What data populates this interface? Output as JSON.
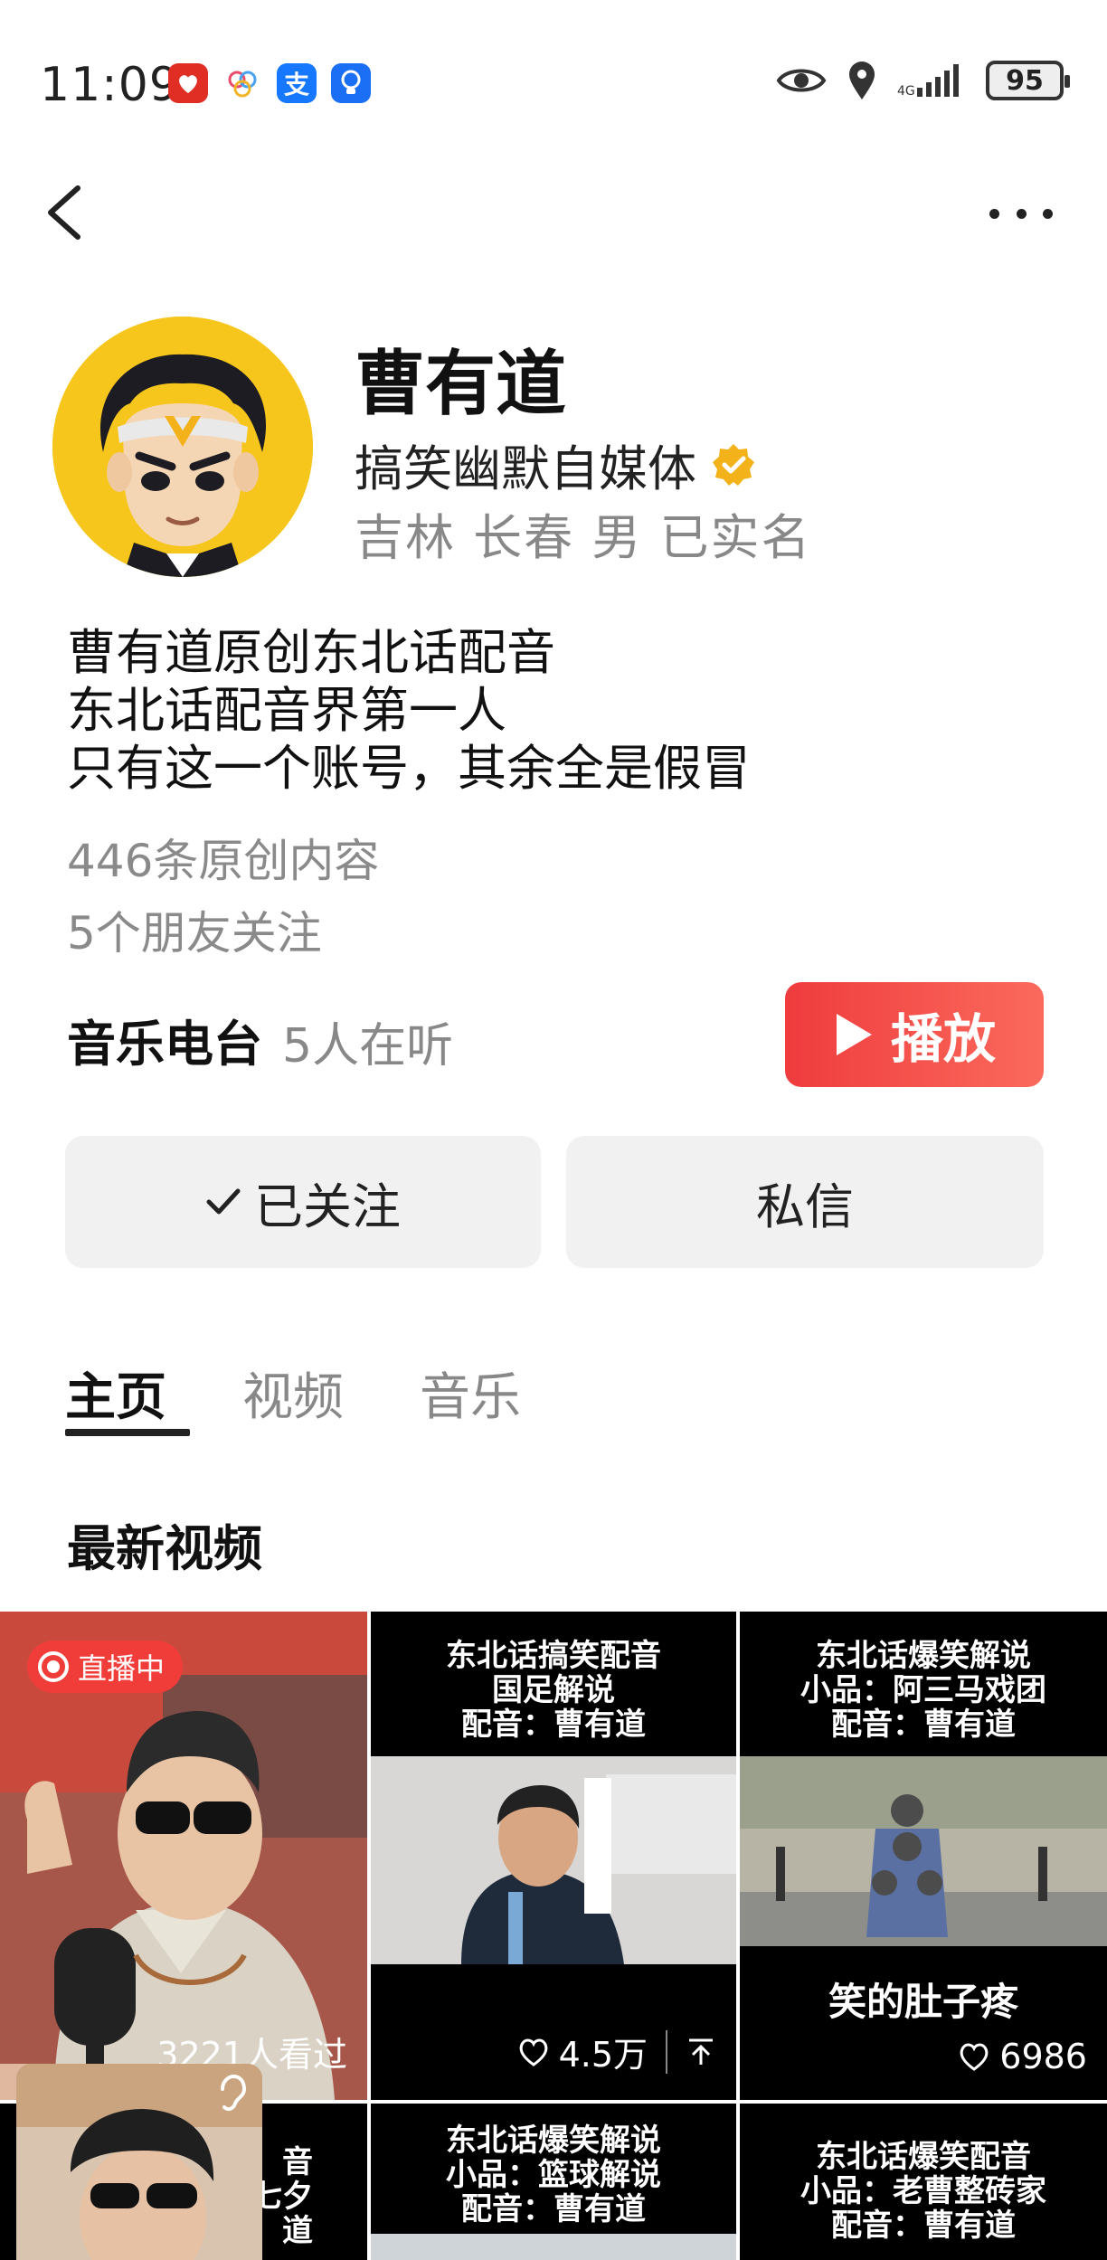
{
  "status_bar": {
    "time": "11:09",
    "battery": "95",
    "icons": [
      "pinduoduo-icon",
      "photos-icon",
      "alipay-icon",
      "bulb-app-icon"
    ]
  },
  "profile": {
    "name": "曹有道",
    "tag": "搞笑幽默自媒体",
    "location": "吉林 长春 男 已实名",
    "bio": [
      "曹有道原创东北话配音",
      "东北话配音界第一人",
      "只有这一个账号，其余全是假冒"
    ],
    "original_count": "446条原创内容",
    "friends_following": "5个朋友关注"
  },
  "radio": {
    "label": "音乐电台",
    "listeners": "5人在听",
    "play_label": "播放"
  },
  "actions": {
    "follow_label": "已关注",
    "message_label": "私信"
  },
  "tabs": [
    "主页",
    "视频",
    "音乐"
  ],
  "section_title": "最新视频",
  "videos": [
    {
      "live": "直播中",
      "views": "3221人看过"
    },
    {
      "title": [
        "东北话搞笑配音",
        "国足解说",
        "配音：曹有道"
      ],
      "likes": "4.5万"
    },
    {
      "title": [
        "东北话爆笑解说",
        "小品：阿三马戏团",
        "配音：曹有道"
      ],
      "caption": "笑的肚子疼",
      "likes": "6986"
    },
    {
      "title": [
        "音",
        "七夕",
        "道"
      ]
    },
    {
      "title": [
        "东北话爆笑解说",
        "小品：篮球解说",
        "配音：曹有道"
      ]
    },
    {
      "title": [
        "东北话爆笑配音",
        "小品：老曹整砖家",
        "配音：曹有道"
      ]
    }
  ],
  "colors": {
    "play_button": "#ef3c3e",
    "live_badge": "#f03d3a",
    "verified": "#f3b21a",
    "avatar_bg": "#f6c61c"
  }
}
